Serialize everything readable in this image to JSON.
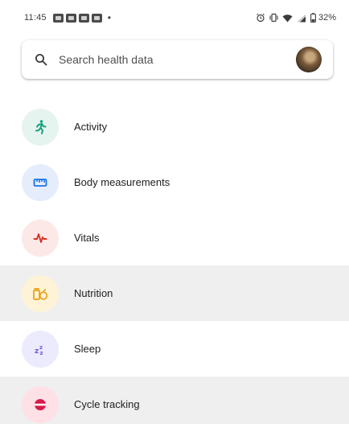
{
  "status_bar": {
    "time": "11:45",
    "battery": "32%"
  },
  "search": {
    "placeholder": "Search health data"
  },
  "categories": [
    {
      "label": "Activity",
      "icon": "running-figure-icon",
      "bg": "#e6f4ef",
      "color": "#13a27a"
    },
    {
      "label": "Body measurements",
      "icon": "ruler-icon",
      "bg": "#e5edfd",
      "color": "#1a73e8"
    },
    {
      "label": "Vitals",
      "icon": "heartbeat-icon",
      "bg": "#fde8e8",
      "color": "#d93025"
    },
    {
      "label": "Nutrition",
      "icon": "apple-jar-icon",
      "bg": "#fef3d6",
      "color": "#e8a013"
    },
    {
      "label": "Sleep",
      "icon": "zzz-icon",
      "bg": "#ecebfd",
      "color": "#6e5ce6"
    },
    {
      "label": "Cycle tracking",
      "icon": "cycle-icon",
      "bg": "#fde1e6",
      "color": "#d81b4a"
    }
  ]
}
